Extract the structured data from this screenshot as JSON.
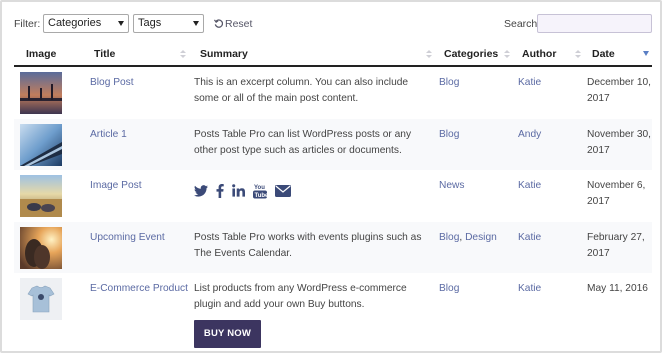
{
  "filter": {
    "label": "Filter:",
    "categories_value": "Categories",
    "tags_value": "Tags",
    "reset_label": "Reset"
  },
  "search": {
    "label": "Search:",
    "placeholder": ""
  },
  "columns": [
    "Image",
    "Title",
    "Summary",
    "Categories",
    "Author",
    "Date"
  ],
  "rows": [
    {
      "title": "Blog Post",
      "summary": "This is an excerpt column. You can also include some or all of the main post content.",
      "categories": [
        "Blog"
      ],
      "author": "Katie",
      "date": "December 10, 2017",
      "thumb": "pier-sunset"
    },
    {
      "title": "Article 1",
      "summary": "Posts Table Pro can list WordPress posts or any other post type such as articles or documents.",
      "categories": [
        "Blog"
      ],
      "author": "Andy",
      "date": "November 30, 2017",
      "thumb": "boat-sky"
    },
    {
      "title": "Image Post",
      "summary": "",
      "categories": [
        "News"
      ],
      "author": "Katie",
      "date": "November 6, 2017",
      "thumb": "field-feet",
      "social_icons": [
        "twitter-icon",
        "facebook-icon",
        "linkedin-icon",
        "youtube-icon",
        "email-icon"
      ]
    },
    {
      "title": "Upcoming Event",
      "summary": "Posts Table Pro works with events plugins such as The Events Calendar.",
      "categories": [
        "Blog",
        "Design"
      ],
      "author": "Katie",
      "date": "February 27, 2017",
      "thumb": "couple-sunset"
    },
    {
      "title": "E-Commerce Product",
      "summary": "List products from any WordPress e-commerce plugin and add your own Buy buttons.",
      "categories": [
        "Blog"
      ],
      "author": "Katie",
      "date": "May 11, 2016",
      "thumb": "tshirt",
      "button": "BUY NOW"
    }
  ],
  "colors": {
    "link": "#5b6aa3",
    "button_bg": "#3c3560",
    "sort_active": "#5a7fc4",
    "header_rule": "#222222"
  }
}
